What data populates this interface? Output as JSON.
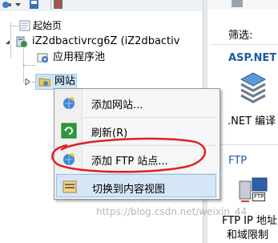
{
  "tree": {
    "start_page": "起始页",
    "server_node": "iZ2dbactivrcg6Z (iZ2dbactiv",
    "app_pools": "应用程序池",
    "sites": "网站"
  },
  "context_menu": {
    "items": [
      {
        "label": "添加网站...",
        "icon": "add-website-icon"
      },
      {
        "label": "刷新(R)",
        "icon": "refresh-icon"
      },
      {
        "label": "添加 FTP 站点...",
        "icon": "add-ftp-site-icon"
      },
      {
        "label": "切换到内容视图",
        "icon": "content-view-icon"
      }
    ]
  },
  "right_panel": {
    "filter_label": "筛选:",
    "aspnet_section": "ASP.NET",
    "net_compile_label": ".NET 编译",
    "ftp_section": "FTP",
    "ftp_badge": "FTP",
    "ftp_ip_label": "FTP IP 地址",
    "ftp_ip_label2": "和域限制"
  },
  "watermark": "https://blog.csdn.net/weixin_44",
  "colors": {
    "menu_highlight": "#d5e6f7",
    "annotation_red": "#e02020",
    "section_blue": "#1e5aa8"
  }
}
